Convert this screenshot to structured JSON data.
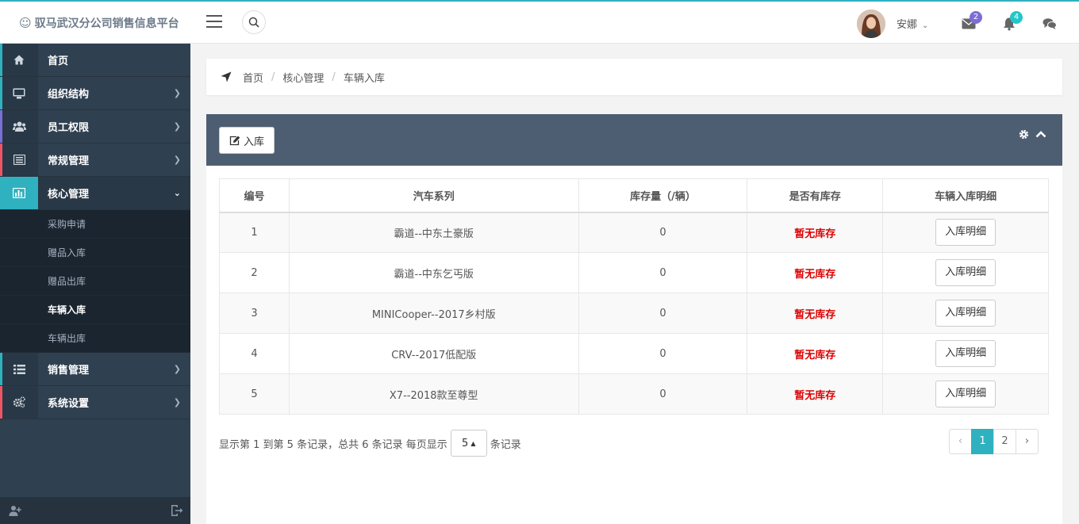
{
  "app": {
    "title": "驭马武汉分公司销售信息平台"
  },
  "header": {
    "user_name": "安娜",
    "mail_count": "2",
    "notif_count": "4",
    "colors": {
      "accent": "#2fb1bf",
      "mail_badge": "#7b6ed6",
      "notif_badge": "#23c6c8"
    }
  },
  "sidebar": {
    "items": [
      {
        "label": "首页",
        "icon": "home-icon",
        "strip": "#2fb1bf"
      },
      {
        "label": "组织结构",
        "icon": "desktop-icon",
        "strip": "#2fb1bf"
      },
      {
        "label": "员工权限",
        "icon": "users-icon",
        "strip": "#7b6ed6"
      },
      {
        "label": "常规管理",
        "icon": "list-alt-icon",
        "strip": "#ed5565"
      },
      {
        "label": "核心管理",
        "icon": "bar-chart-icon",
        "strip": "#2fb1bf"
      },
      {
        "label": "销售管理",
        "icon": "list-icon",
        "strip": "#2fb1bf"
      },
      {
        "label": "系统设置",
        "icon": "cogs-icon",
        "strip": "#ed5565"
      }
    ],
    "sub_items": [
      "采购申请",
      "赠品入库",
      "赠品出库",
      "车辆入库",
      "车辆出库"
    ]
  },
  "breadcrumb": {
    "home": "首页",
    "section": "核心管理",
    "current": "车辆入库"
  },
  "panel": {
    "in_button": "入库"
  },
  "table": {
    "headers": [
      "编号",
      "汽车系列",
      "库存量（/辆）",
      "是否有库存",
      "车辆入库明细"
    ],
    "rows": [
      {
        "id": "1",
        "series": "霸道--中东土豪版",
        "qty": "0",
        "stock": "暂无库存",
        "action": "入库明细"
      },
      {
        "id": "2",
        "series": "霸道--中东乞丐版",
        "qty": "0",
        "stock": "暂无库存",
        "action": "入库明细"
      },
      {
        "id": "3",
        "series": "MINICooper--2017乡村版",
        "qty": "0",
        "stock": "暂无库存",
        "action": "入库明细"
      },
      {
        "id": "4",
        "series": "CRV--2017低配版",
        "qty": "0",
        "stock": "暂无库存",
        "action": "入库明细"
      },
      {
        "id": "5",
        "series": "X7--2018款至尊型",
        "qty": "0",
        "stock": "暂无库存",
        "action": "入库明细"
      }
    ]
  },
  "pager": {
    "info_before": "显示第 1 到第 5 条记录，总共 6 条记录 每页显示",
    "page_size": "5",
    "info_after": "条记录",
    "prev": "‹",
    "pages": [
      "1",
      "2"
    ],
    "next": "›"
  }
}
